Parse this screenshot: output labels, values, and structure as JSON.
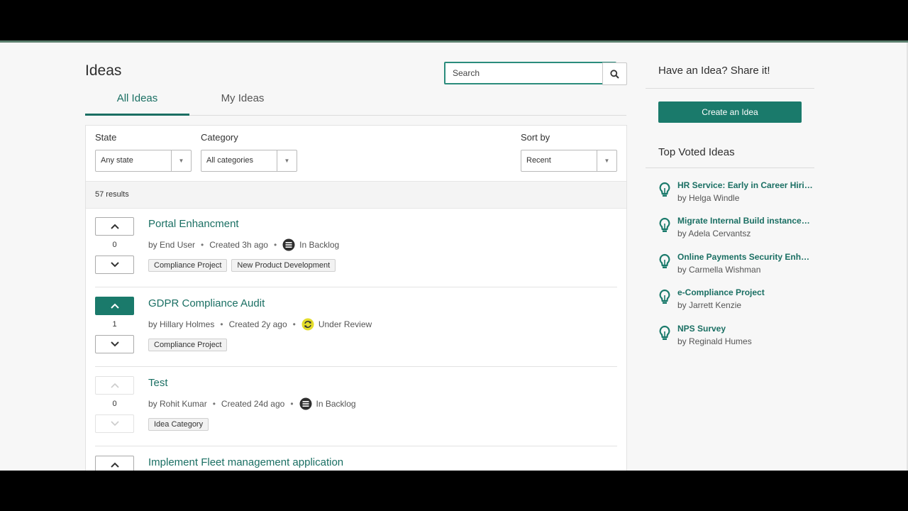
{
  "header": {
    "page_title": "Ideas"
  },
  "search": {
    "placeholder": "Search"
  },
  "tabs": [
    {
      "label": "All Ideas"
    },
    {
      "label": "My Ideas"
    }
  ],
  "filters": {
    "state": {
      "label": "State",
      "value": "Any state"
    },
    "category": {
      "label": "Category",
      "value": "All categories"
    },
    "sort": {
      "label": "Sort by",
      "value": "Recent"
    }
  },
  "results_text": "57 results",
  "ideas": [
    {
      "title": "Portal Enhancment",
      "votes": "0",
      "author": "by End User",
      "created": "Created 3h ago",
      "status": "In Backlog",
      "status_icon": "backlog-icon",
      "tags": [
        "Compliance Project",
        "New Product Development"
      ]
    },
    {
      "title": "GDPR Compliance Audit",
      "votes": "1",
      "author": "by Hillary Holmes",
      "created": "Created 2y ago",
      "status": "Under Review",
      "status_icon": "review-icon",
      "tags": [
        "Compliance Project"
      ]
    },
    {
      "title": "Test",
      "votes": "0",
      "author": "by Rohit Kumar",
      "created": "Created 24d ago",
      "status": "In Backlog",
      "status_icon": "backlog-icon",
      "tags": [
        "Idea Category"
      ]
    },
    {
      "title": "Implement Fleet management application"
    }
  ],
  "sidebar": {
    "share_title": "Have an Idea? Share it!",
    "create_label": "Create an Idea",
    "top_title": "Top Voted Ideas",
    "top_ideas": [
      {
        "title": "HR Service: Early in Career Hiring",
        "author": "by Helga Windle"
      },
      {
        "title": "Migrate Internal Build instances t…",
        "author": "by Adela Cervantsz"
      },
      {
        "title": "Online Payments Security Enhan…",
        "author": "by Carmella Wishman"
      },
      {
        "title": "e-Compliance Project",
        "author": "by Jarrett Kenzie"
      },
      {
        "title": "NPS Survey",
        "author": "by Reginald Humes"
      }
    ]
  },
  "colors": {
    "accent": "#1a7a6b",
    "search_border": "#2b8c7c",
    "review_badge": "#e3dc2a"
  }
}
